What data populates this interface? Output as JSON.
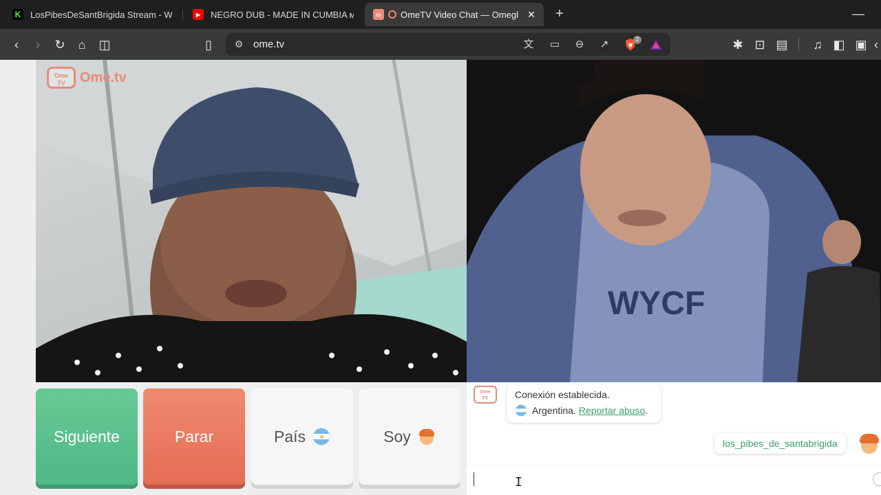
{
  "browser": {
    "tabs": [
      {
        "title": "LosPibesDeSantBrigida Stream - Wat",
        "favicon": "kick-icon",
        "favicon_color": "#53fc18"
      },
      {
        "title": "NEGRO DUB - MADE IN CUMBIA ᴍxᴀ",
        "favicon": "youtube-icon",
        "favicon_color": "#ff0000"
      },
      {
        "title": "OmeTV Video Chat — Omegl",
        "favicon": "ometv-icon",
        "favicon_color": "#e88b7a",
        "active": true
      }
    ],
    "url": "ome.tv",
    "brave_badge": "2"
  },
  "page": {
    "logo_text": "Ome.tv",
    "logo_small": "Ome TV",
    "buttons": {
      "next": "Siguiente",
      "stop": "Parar",
      "country": "País",
      "gender": "Soy"
    },
    "chat": {
      "system_line1": "Conexión establecida.",
      "system_country": "Argentina.",
      "report_link": "Reportar abuso",
      "report_suffix": ".",
      "user_message": "los_pibes_de_santabrigida"
    }
  },
  "colors": {
    "accent_green": "#4fb985",
    "accent_red": "#e56d55",
    "brand": "#e88b7a",
    "link": "#3aa06b"
  }
}
